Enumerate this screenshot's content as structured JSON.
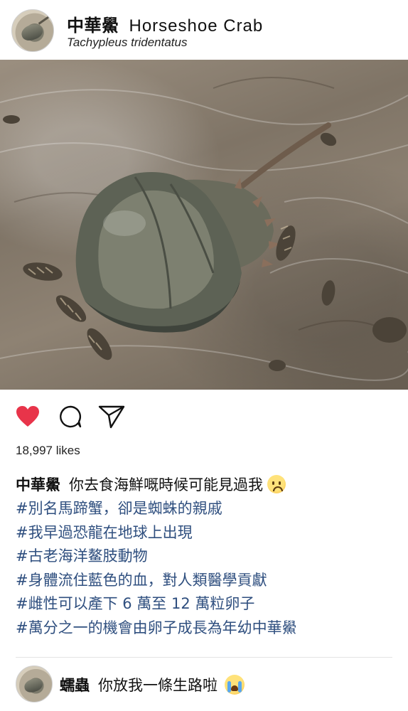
{
  "post": {
    "username": "中華鱟",
    "title_en": "Horseshoe Crab",
    "subtitle": "Tachypleus tridentatus"
  },
  "photo": {
    "subject": "horseshoe crab on wet sand with sea snails"
  },
  "actions": {
    "like_icon": "heart-icon",
    "like_color": "#e8344a",
    "comment_icon": "comment-icon",
    "share_icon": "send-icon"
  },
  "likes": "18,997 likes",
  "caption": {
    "username": "中華鱟",
    "text": "你去食海鮮嘅時候可能見過我",
    "emoji": "crying-face-emoji",
    "hashtags": [
      "#別名馬蹄蟹，卻是蜘蛛的親戚",
      "#我早過恐龍在地球上出現",
      "#古老海洋鳌肢動物",
      "#身體流住藍色的血，對人類醫學貢獻",
      "#雌性可以產下 6 萬至 12 萬粒卵子",
      "#萬分之一的機會由卵子成長為年幼中華鱟"
    ],
    "hashtag_color": "#2f4f7f"
  },
  "comment": {
    "username": "蠕蟲",
    "text": "你放我一條生路啦",
    "emoji": "loudly-crying-face-emoji"
  }
}
